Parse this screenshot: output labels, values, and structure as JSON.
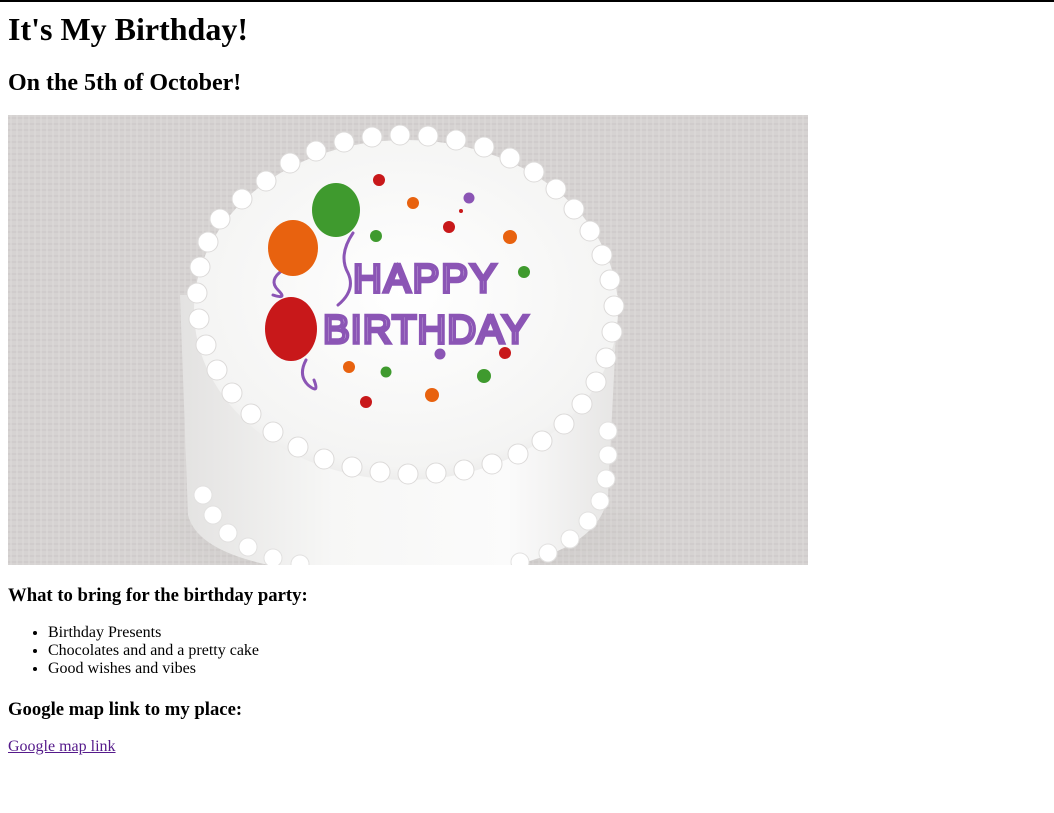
{
  "heading": "It's My Birthday!",
  "subheading": "On the 5th of October!",
  "image": {
    "cake_text_line1": "HAPPY",
    "cake_text_line2": "BIRTHDAY"
  },
  "bring_section": {
    "title": "What to bring for the birthday party:",
    "items": [
      "Birthday Presents",
      "Chocolates and and a pretty cake",
      "Good wishes and vibes"
    ]
  },
  "map_section": {
    "title": "Google map link to my place:",
    "link_text": "Google map link"
  },
  "colors": {
    "link_visited": "#551a8b",
    "frosting_text": "#8b55b5",
    "balloon_orange": "#e8620f",
    "balloon_green": "#3f9a2e",
    "balloon_red": "#c8181a"
  }
}
